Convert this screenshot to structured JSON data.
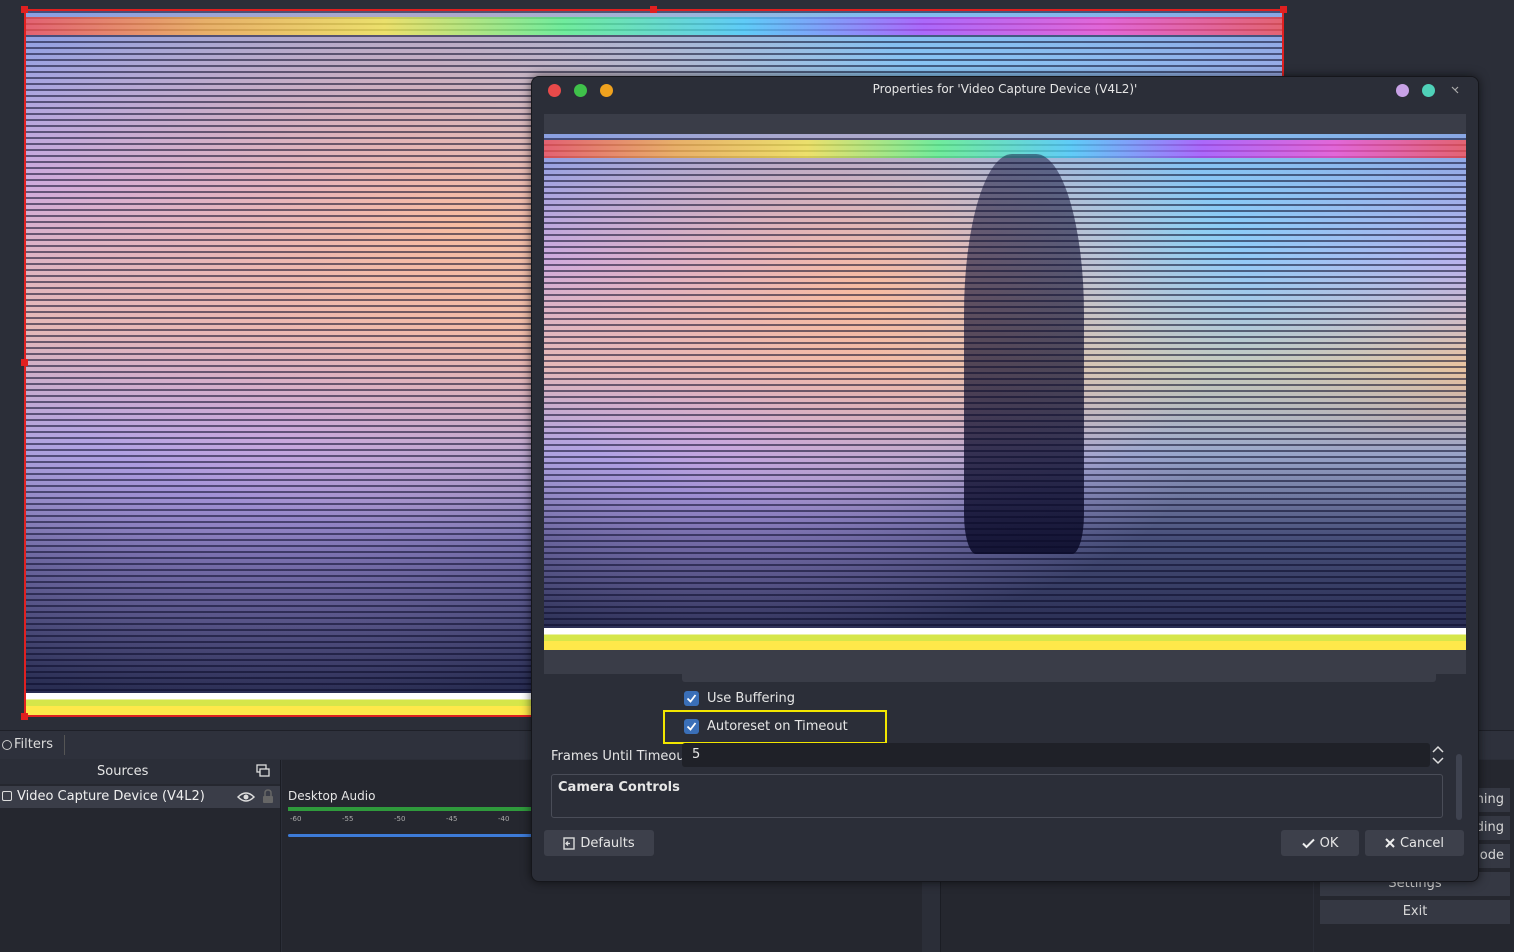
{
  "docks": {
    "filters_label": "Filters",
    "sources_title": "Sources",
    "source_item": "Video Capture Device (V4L2)",
    "mixer_track": "Desktop Audio",
    "mixer_ticks": [
      "-60",
      "-55",
      "-50",
      "-45",
      "-40"
    ]
  },
  "controls": {
    "streaming_partial": "ming",
    "recording_partial": "rding",
    "studio_mode_partial": "ode",
    "settings": "Settings",
    "exit": "Exit"
  },
  "dialog": {
    "title": "Properties for 'Video Capture Device (V4L2)'",
    "use_buffering": "Use Buffering",
    "use_buffering_checked": true,
    "autoreset_on_timeout": "Autoreset on Timeout",
    "autoreset_checked": true,
    "frames_until_timeout_label": "Frames Until Timeout",
    "frames_until_timeout_value": "5",
    "camera_controls": "Camera Controls",
    "defaults_button": "Defaults",
    "ok_button": "OK",
    "cancel_button": "Cancel"
  },
  "colors": {
    "close": "#e84a4a",
    "minimize": "#3fc14a",
    "maximize": "#f0a21e",
    "keep_above": "#c8a2e6",
    "shade": "#4fd1b8",
    "highlight": "#f2e600",
    "selection": "#e02020"
  }
}
